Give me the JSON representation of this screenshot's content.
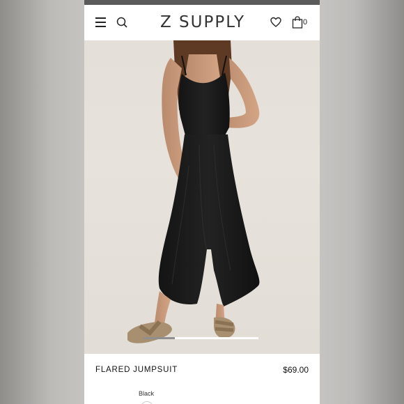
{
  "header": {
    "logo": "Z SUPPLY",
    "cart_count": "0",
    "icons": [
      "menu-icon",
      "search-icon",
      "heart-icon",
      "bag-icon"
    ]
  },
  "carousel": {
    "active_slide_fraction": 0.27
  },
  "product": {
    "name": "FLARED JUMPSUIT",
    "price": "$69.00",
    "color_label": "Black"
  },
  "colors": {
    "text": "#111111",
    "header_bg": "#ffffff",
    "product_color": "#1a1a1a"
  }
}
